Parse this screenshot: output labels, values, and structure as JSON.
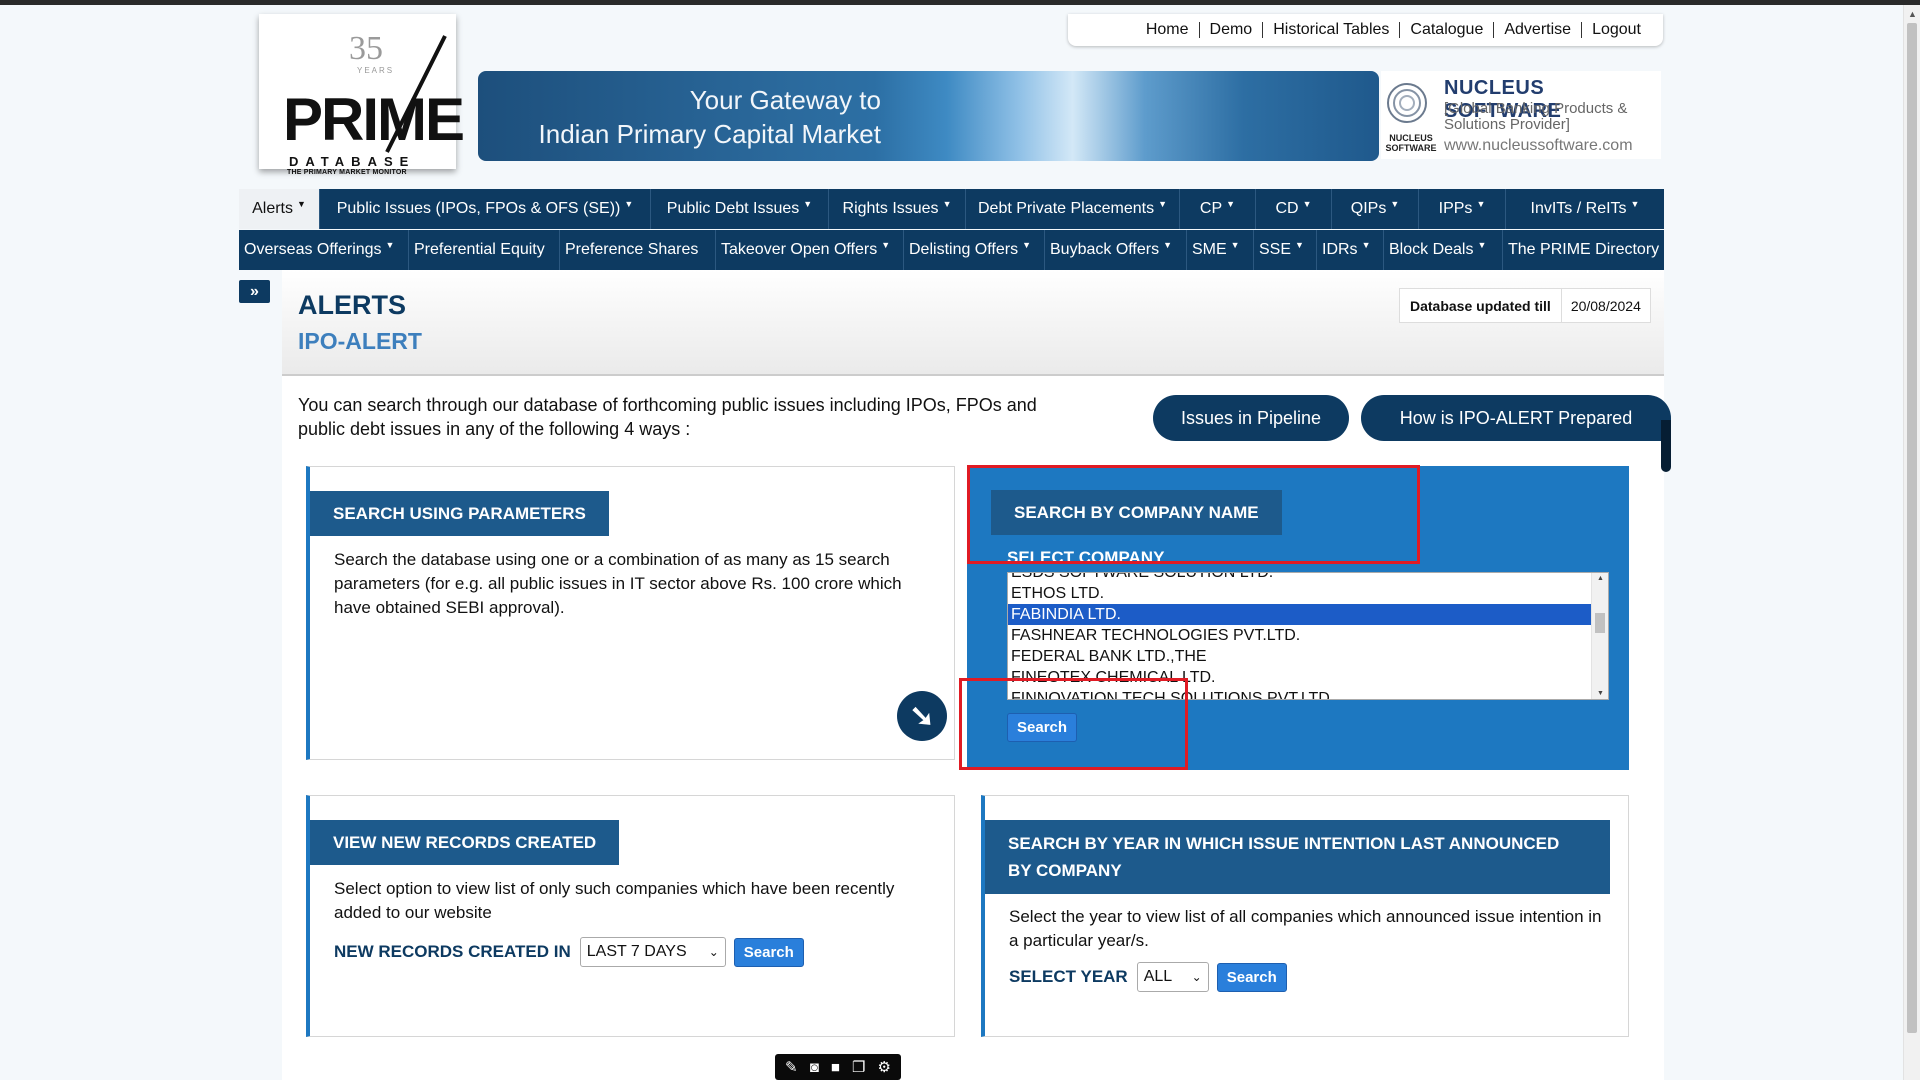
{
  "logo": {
    "years": "35",
    "years_label": "YEARS",
    "name": "PRIME",
    "database": "DATABASE",
    "tagline": "THE PRIMARY MARKET MONITOR"
  },
  "top_nav": [
    "Home",
    "Demo",
    "Historical Tables",
    "Catalogue",
    "Advertise",
    "Logout"
  ],
  "banner": {
    "line1": "Your Gateway to",
    "line2": "Indian Primary Capital Market"
  },
  "sponsor": {
    "small_label": "NUCLEUS SOFTWARE",
    "title": "NUCLEUS SOFTWARE",
    "subtitle": "[Global Banking Products & Solutions Provider]",
    "url": "www.nucleussoftware.com"
  },
  "main_nav": [
    {
      "label": "Alerts",
      "dropdown": true,
      "active": true
    },
    {
      "label": "Public Issues (IPOs, FPOs & OFS (SE))",
      "dropdown": true
    },
    {
      "label": "Public Debt Issues",
      "dropdown": true
    },
    {
      "label": "Rights Issues",
      "dropdown": true
    },
    {
      "label": "Debt Private Placements",
      "dropdown": true
    },
    {
      "label": "CP",
      "dropdown": true
    },
    {
      "label": "CD",
      "dropdown": true
    },
    {
      "label": "QIPs",
      "dropdown": true
    },
    {
      "label": "IPPs",
      "dropdown": true
    },
    {
      "label": "InvITs / ReITs",
      "dropdown": true
    }
  ],
  "second_nav": [
    {
      "label": "Overseas Offerings",
      "dropdown": true
    },
    {
      "label": "Preferential Equity",
      "dropdown": false
    },
    {
      "label": "Preference Shares",
      "dropdown": false
    },
    {
      "label": "Takeover Open Offers",
      "dropdown": true
    },
    {
      "label": "Delisting Offers",
      "dropdown": true
    },
    {
      "label": "Buyback Offers",
      "dropdown": true
    },
    {
      "label": "SME",
      "dropdown": true
    },
    {
      "label": "SSE",
      "dropdown": true
    },
    {
      "label": "IDRs",
      "dropdown": true
    },
    {
      "label": "Block Deals",
      "dropdown": true
    },
    {
      "label": "The PRIME Directory",
      "dropdown": false
    }
  ],
  "page": {
    "title": "ALERTS",
    "subtitle": "IPO-ALERT",
    "db_updated_label": "Database updated till",
    "db_updated_value": "20/08/2024",
    "intro": "You can search through our database of forthcoming public issues including IPOs, FPOs and public debt issues in any of the following 4 ways :",
    "pill_pipeline": "Issues in Pipeline",
    "pill_how": "How is IPO-ALERT Prepared"
  },
  "card_params": {
    "heading": "SEARCH USING PARAMETERS",
    "body": "Search the database using one or a combination of as many as 15 search parameters (for e.g. all public issues in IT sector above Rs. 100 crore which have obtained SEBI approval)."
  },
  "card_company": {
    "heading": "SEARCH BY COMPANY NAME",
    "select_label": "SELECT COMPANY",
    "options": [
      "ESDS SOFTWARE SOLUTION LTD.",
      "ETHOS LTD.",
      "FABINDIA LTD.",
      "FASHNEAR TECHNOLOGIES PVT.LTD.",
      "FEDERAL BANK LTD.,THE",
      "FINEOTEX CHEMICAL LTD.",
      "FINNOVATION TECH SOLUTIONS PVT.LTD."
    ],
    "selected": "FABINDIA LTD.",
    "search_label": "Search"
  },
  "card_new_records": {
    "heading": "VIEW NEW RECORDS CREATED",
    "body": "Select option to view list of only such companies which have been recently added to our website",
    "row_label": "NEW RECORDS CREATED IN",
    "select_value": "LAST 7 DAYS",
    "search_label": "Search"
  },
  "card_year": {
    "heading": "SEARCH BY YEAR IN WHICH ISSUE INTENTION LAST ANNOUNCED BY COMPANY",
    "body": "Select the year to view list of all companies which announced issue intention in a particular year/s.",
    "row_label": "SELECT YEAR",
    "select_value": "ALL",
    "search_label": "Search"
  },
  "colors": {
    "nav": "#0d3a61",
    "accent": "#1d78c1",
    "card_head": "#1d5a8c",
    "highlight": "#e01b24",
    "selected": "#1c5cc7"
  },
  "icons": {
    "expand": "double-chevron-right-icon",
    "go": "arrow-down-right-icon",
    "toolbar": [
      "pen-icon",
      "camera-icon",
      "video-icon",
      "copy-icon",
      "gear-icon"
    ]
  }
}
